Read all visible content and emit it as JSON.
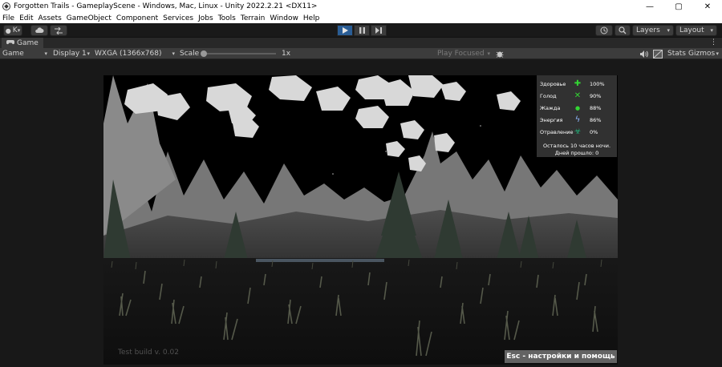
{
  "window": {
    "title": "Forgotten Trails - GameplayScene - Windows, Mac, Linux - Unity 2022.2.21 <DX11>",
    "minimize_glyph": "—",
    "maximize_glyph": "▢",
    "close_glyph": "✕"
  },
  "menu": [
    "File",
    "Edit",
    "Assets",
    "GameObject",
    "Component",
    "Services",
    "Jobs",
    "Tools",
    "Terrain",
    "Window",
    "Help"
  ],
  "toolbar": {
    "account_label": "K",
    "layers_label": "Layers",
    "layout_label": "Layout"
  },
  "tab": {
    "label": "Game",
    "more_glyph": "⋮"
  },
  "gamebar": {
    "view_mode": "Game",
    "display": "Display 1",
    "resolution": "WXGA (1366x768)",
    "scale_label": "Scale",
    "scale_value": "1x",
    "scale_fraction": 0,
    "play_focused": "Play Focused",
    "stats_label": "Stats",
    "gizmos_label": "Gizmos"
  },
  "hud": {
    "stats": [
      {
        "label": "Здоровье",
        "value": "100%",
        "icon": "health-cross-icon",
        "color": "#33d633",
        "glyph": "✚"
      },
      {
        "label": "Голод",
        "value": "90%",
        "icon": "hunger-cutlery-icon",
        "color": "#33d633",
        "glyph": "✕"
      },
      {
        "label": "Жажда",
        "value": "88%",
        "icon": "thirst-drop-icon",
        "color": "#33d633",
        "glyph": "●"
      },
      {
        "label": "Энергия",
        "value": "86%",
        "icon": "energy-bolt-icon",
        "color": "#8fb8ff",
        "glyph": "ϟ"
      },
      {
        "label": "Отравление",
        "value": "0%",
        "icon": "poison-icon",
        "color": "#22b37a",
        "glyph": "☣"
      }
    ],
    "time_left": "Осталось 10 часов ночи.",
    "days_passed": "Дней прошло: 0"
  },
  "build_text": "Test build v. 0.02",
  "esc_hint": "Esc - настройки и помощь",
  "colors": {
    "editor_bg": "#191919",
    "toolbar_bg": "#3c3c3c",
    "play_active": "#2a5d95",
    "hud_bg": "#3c3c3c"
  }
}
